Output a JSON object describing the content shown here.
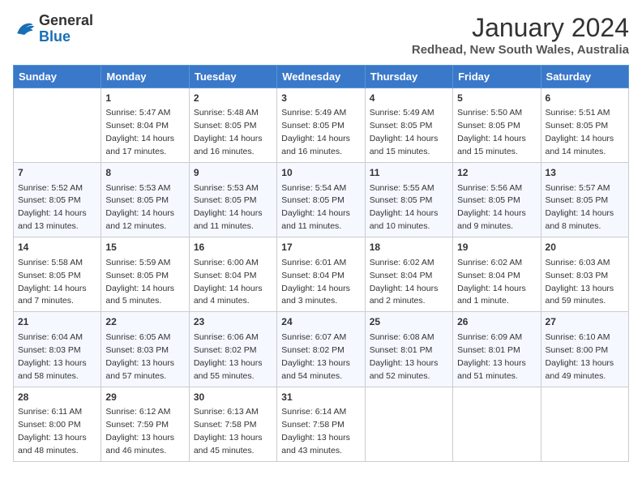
{
  "header": {
    "logo_line1": "General",
    "logo_line2": "Blue",
    "month_title": "January 2024",
    "location": "Redhead, New South Wales, Australia"
  },
  "weekdays": [
    "Sunday",
    "Monday",
    "Tuesday",
    "Wednesday",
    "Thursday",
    "Friday",
    "Saturday"
  ],
  "weeks": [
    [
      {
        "day": "",
        "info": ""
      },
      {
        "day": "1",
        "info": "Sunrise: 5:47 AM\nSunset: 8:04 PM\nDaylight: 14 hours\nand 17 minutes."
      },
      {
        "day": "2",
        "info": "Sunrise: 5:48 AM\nSunset: 8:05 PM\nDaylight: 14 hours\nand 16 minutes."
      },
      {
        "day": "3",
        "info": "Sunrise: 5:49 AM\nSunset: 8:05 PM\nDaylight: 14 hours\nand 16 minutes."
      },
      {
        "day": "4",
        "info": "Sunrise: 5:49 AM\nSunset: 8:05 PM\nDaylight: 14 hours\nand 15 minutes."
      },
      {
        "day": "5",
        "info": "Sunrise: 5:50 AM\nSunset: 8:05 PM\nDaylight: 14 hours\nand 15 minutes."
      },
      {
        "day": "6",
        "info": "Sunrise: 5:51 AM\nSunset: 8:05 PM\nDaylight: 14 hours\nand 14 minutes."
      }
    ],
    [
      {
        "day": "7",
        "info": "Sunrise: 5:52 AM\nSunset: 8:05 PM\nDaylight: 14 hours\nand 13 minutes."
      },
      {
        "day": "8",
        "info": "Sunrise: 5:53 AM\nSunset: 8:05 PM\nDaylight: 14 hours\nand 12 minutes."
      },
      {
        "day": "9",
        "info": "Sunrise: 5:53 AM\nSunset: 8:05 PM\nDaylight: 14 hours\nand 11 minutes."
      },
      {
        "day": "10",
        "info": "Sunrise: 5:54 AM\nSunset: 8:05 PM\nDaylight: 14 hours\nand 11 minutes."
      },
      {
        "day": "11",
        "info": "Sunrise: 5:55 AM\nSunset: 8:05 PM\nDaylight: 14 hours\nand 10 minutes."
      },
      {
        "day": "12",
        "info": "Sunrise: 5:56 AM\nSunset: 8:05 PM\nDaylight: 14 hours\nand 9 minutes."
      },
      {
        "day": "13",
        "info": "Sunrise: 5:57 AM\nSunset: 8:05 PM\nDaylight: 14 hours\nand 8 minutes."
      }
    ],
    [
      {
        "day": "14",
        "info": "Sunrise: 5:58 AM\nSunset: 8:05 PM\nDaylight: 14 hours\nand 7 minutes."
      },
      {
        "day": "15",
        "info": "Sunrise: 5:59 AM\nSunset: 8:05 PM\nDaylight: 14 hours\nand 5 minutes."
      },
      {
        "day": "16",
        "info": "Sunrise: 6:00 AM\nSunset: 8:04 PM\nDaylight: 14 hours\nand 4 minutes."
      },
      {
        "day": "17",
        "info": "Sunrise: 6:01 AM\nSunset: 8:04 PM\nDaylight: 14 hours\nand 3 minutes."
      },
      {
        "day": "18",
        "info": "Sunrise: 6:02 AM\nSunset: 8:04 PM\nDaylight: 14 hours\nand 2 minutes."
      },
      {
        "day": "19",
        "info": "Sunrise: 6:02 AM\nSunset: 8:04 PM\nDaylight: 14 hours\nand 1 minute."
      },
      {
        "day": "20",
        "info": "Sunrise: 6:03 AM\nSunset: 8:03 PM\nDaylight: 13 hours\nand 59 minutes."
      }
    ],
    [
      {
        "day": "21",
        "info": "Sunrise: 6:04 AM\nSunset: 8:03 PM\nDaylight: 13 hours\nand 58 minutes."
      },
      {
        "day": "22",
        "info": "Sunrise: 6:05 AM\nSunset: 8:03 PM\nDaylight: 13 hours\nand 57 minutes."
      },
      {
        "day": "23",
        "info": "Sunrise: 6:06 AM\nSunset: 8:02 PM\nDaylight: 13 hours\nand 55 minutes."
      },
      {
        "day": "24",
        "info": "Sunrise: 6:07 AM\nSunset: 8:02 PM\nDaylight: 13 hours\nand 54 minutes."
      },
      {
        "day": "25",
        "info": "Sunrise: 6:08 AM\nSunset: 8:01 PM\nDaylight: 13 hours\nand 52 minutes."
      },
      {
        "day": "26",
        "info": "Sunrise: 6:09 AM\nSunset: 8:01 PM\nDaylight: 13 hours\nand 51 minutes."
      },
      {
        "day": "27",
        "info": "Sunrise: 6:10 AM\nSunset: 8:00 PM\nDaylight: 13 hours\nand 49 minutes."
      }
    ],
    [
      {
        "day": "28",
        "info": "Sunrise: 6:11 AM\nSunset: 8:00 PM\nDaylight: 13 hours\nand 48 minutes."
      },
      {
        "day": "29",
        "info": "Sunrise: 6:12 AM\nSunset: 7:59 PM\nDaylight: 13 hours\nand 46 minutes."
      },
      {
        "day": "30",
        "info": "Sunrise: 6:13 AM\nSunset: 7:58 PM\nDaylight: 13 hours\nand 45 minutes."
      },
      {
        "day": "31",
        "info": "Sunrise: 6:14 AM\nSunset: 7:58 PM\nDaylight: 13 hours\nand 43 minutes."
      },
      {
        "day": "",
        "info": ""
      },
      {
        "day": "",
        "info": ""
      },
      {
        "day": "",
        "info": ""
      }
    ]
  ]
}
